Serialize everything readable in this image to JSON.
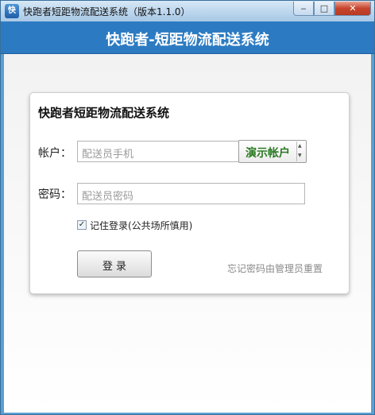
{
  "window": {
    "title": "快跑者短距物流配送系统（版本1.1.0）",
    "icon_name": "app-icon",
    "icon_text": "快",
    "controls": {
      "minimize": "‒",
      "maximize": "□",
      "close": "✕"
    }
  },
  "header": {
    "title": "快跑者-短距物流配送系统"
  },
  "panel": {
    "title": "快跑者短距物流配送系统",
    "account": {
      "label": "帐户：",
      "placeholder": "配送员手机"
    },
    "demo_account": {
      "label": "演示帐户",
      "up": "▲",
      "down": "▼"
    },
    "password": {
      "label": "密码：",
      "placeholder": "配送员密码"
    },
    "remember": {
      "checked": true,
      "check_mark": "✓",
      "label": "记住登录(公共场所慎用)"
    },
    "login_button": "登 录",
    "forgot_note": "忘记密码由管理员重置"
  },
  "colors": {
    "header": "#2c7bc2",
    "demo_text": "#2a7a22",
    "close_button": "#c8452c"
  }
}
